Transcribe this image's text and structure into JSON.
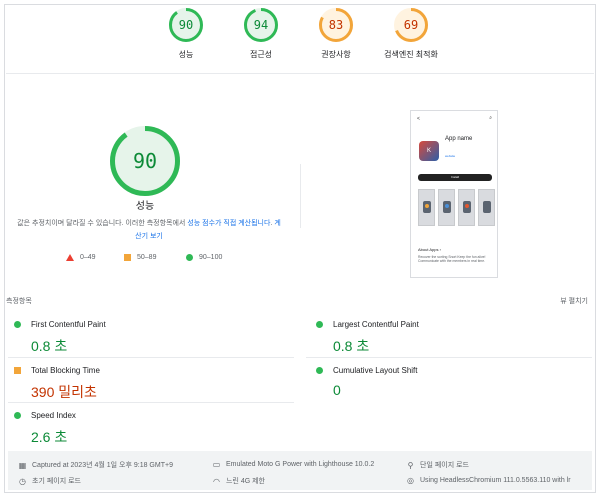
{
  "top_scores": [
    {
      "score": "90",
      "label": "성능",
      "value": 0.9,
      "color": "#0c8a37",
      "track": "#e6f4ea",
      "stroke": "#2fb956"
    },
    {
      "score": "94",
      "label": "접근성",
      "value": 0.94,
      "color": "#0c8a37",
      "track": "#e6f4ea",
      "stroke": "#2fb956"
    },
    {
      "score": "83",
      "label": "권장사항",
      "value": 0.83,
      "color": "#c33300",
      "track": "#fff3e0",
      "stroke": "#f2a53a"
    },
    {
      "score": "69",
      "label": "검색엔진 최적화",
      "value": 0.69,
      "color": "#c33300",
      "track": "#fff3e0",
      "stroke": "#f2a53a"
    }
  ],
  "main": {
    "score": "90",
    "value": 0.9,
    "title": "성능",
    "disclaimer_prefix": "값은 추정치이며 달라질 수 있습니다. 이러한 측정항목에서 ",
    "disclaimer_link1": "성능 점수가 직접 계산됩니다",
    "disclaimer_suffix": ". ",
    "disclaimer_link2": "계산기 보기"
  },
  "legend": [
    {
      "label": "0–49",
      "shape": "triangle",
      "color": "#eb3f32"
    },
    {
      "label": "50–89",
      "shape": "square",
      "color": "#f2a53a"
    },
    {
      "label": "90–100",
      "shape": "circle",
      "color": "#2fb956"
    }
  ],
  "phone_preview": {
    "back": "<",
    "search": "⌕",
    "app_name": "App name",
    "app_letter": "K",
    "app_link": "website",
    "install": "Install",
    "about": "About Apps  ›",
    "description": "Recover the sorting Snort Keep the fun alive! Communicate with the members in real time."
  },
  "metrics_header": "측정항목",
  "view_toggle": "뷰 펼치기",
  "metrics": [
    {
      "name": "First Contentful Paint",
      "value": "0.8 초",
      "status": "good"
    },
    {
      "name": "Largest Contentful Paint",
      "value": "0.8 초",
      "status": "good"
    },
    {
      "name": "Total Blocking Time",
      "value": "390 밀리초",
      "status": "average"
    },
    {
      "name": "Cumulative Layout Shift",
      "value": "0",
      "status": "good"
    },
    {
      "name": "Speed Index",
      "value": "2.6 초",
      "status": "good"
    }
  ],
  "footer": {
    "captured": "Captured at 2023년 4월 1일 오후 9:18 GMT+9",
    "device": "Emulated Moto G Power with Lighthouse 10.0.2",
    "session": "단일 페이지 로드",
    "initial": "초기 페이지 로드",
    "network": "느린 4G 제한",
    "browser": "Using HeadlessChromium 111.0.5563.110 with lr"
  }
}
